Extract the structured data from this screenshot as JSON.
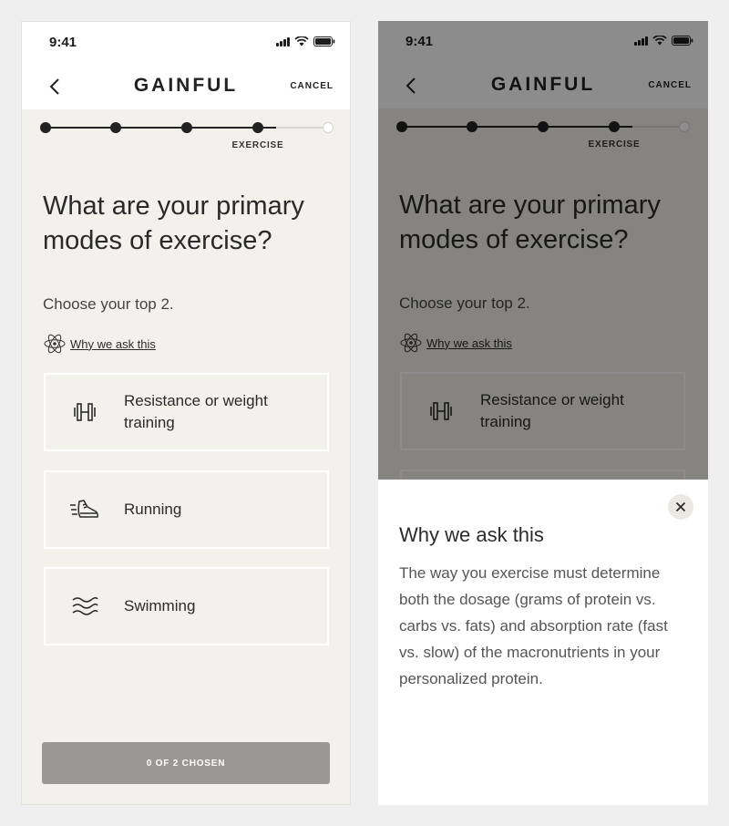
{
  "status_bar": {
    "time": "9:41"
  },
  "nav": {
    "brand": "GAINFUL",
    "cancel_label": "CANCEL"
  },
  "progress": {
    "steps_total": 5,
    "current_step": 4,
    "current_label": "EXERCISE"
  },
  "question": {
    "title": "What are your primary modes of exercise?",
    "subtitle": "Choose your top 2."
  },
  "why_link": {
    "label": "Why we ask this"
  },
  "options": [
    {
      "label": "Resistance or weight training",
      "icon": "dumbbell-icon"
    },
    {
      "label": "Running",
      "icon": "running-shoe-icon"
    },
    {
      "label": "Swimming",
      "icon": "waves-icon"
    }
  ],
  "cta": {
    "label": "0 OF 2 CHOSEN"
  },
  "sheet": {
    "title": "Why we ask this",
    "body": "The way you exercise must determine both the dosage (grams of protein vs. carbs vs. fats) and absorption rate (fast vs. slow) of the macronutrients in your personalized protein."
  },
  "colors": {
    "background": "#efefef",
    "screen": "#f3f1ec",
    "cta_disabled": "#9a9894",
    "overlay": "rgba(0,0,0,0.45)",
    "close_button": "#ebe9e2"
  }
}
